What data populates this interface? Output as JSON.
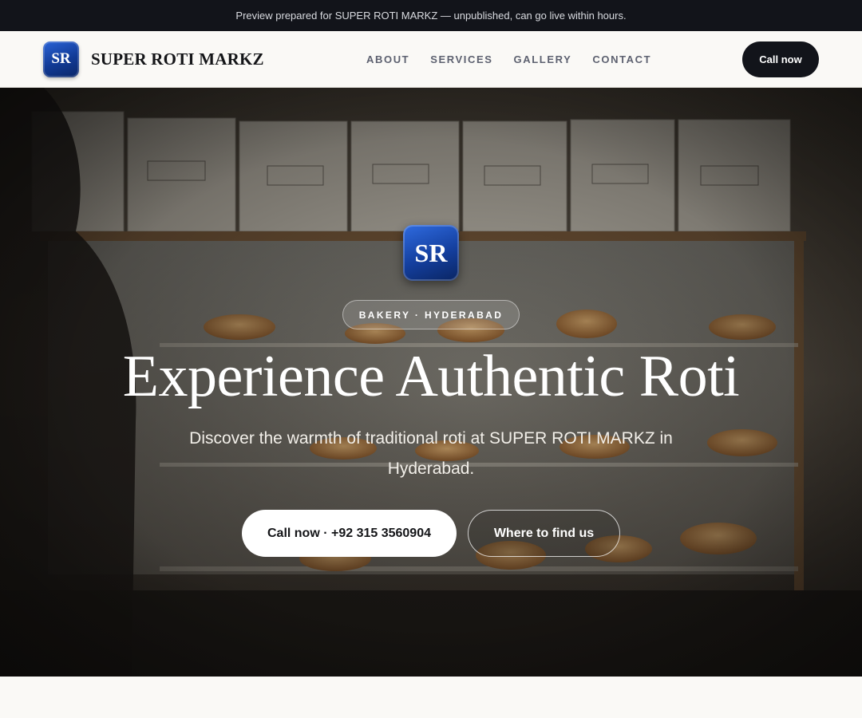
{
  "banner": {
    "text": "Preview prepared for SUPER ROTI MARKZ — unpublished, can go live within hours."
  },
  "header": {
    "logo_initials": "SR",
    "brand_name": "SUPER ROTI MARKZ",
    "nav": [
      "ABOUT",
      "SERVICES",
      "GALLERY",
      "CONTACT"
    ],
    "cta_label": "Call now"
  },
  "hero": {
    "logo_initials": "SR",
    "badge": "BAKERY · HYDERABAD",
    "headline": "Experience Authentic Roti",
    "subtitle": "Discover the warmth of traditional roti at SUPER ROTI MARKZ in Hyderabad.",
    "primary_button": "Call now · +92 315 3560904",
    "secondary_button": "Where to find us",
    "background_image": "bakery display case with pastries and boxes"
  },
  "colors": {
    "dark": "#12141a",
    "accent_blue": "#143f9e",
    "page_bg": "#faf9f6",
    "nav_text": "#5d6170"
  }
}
